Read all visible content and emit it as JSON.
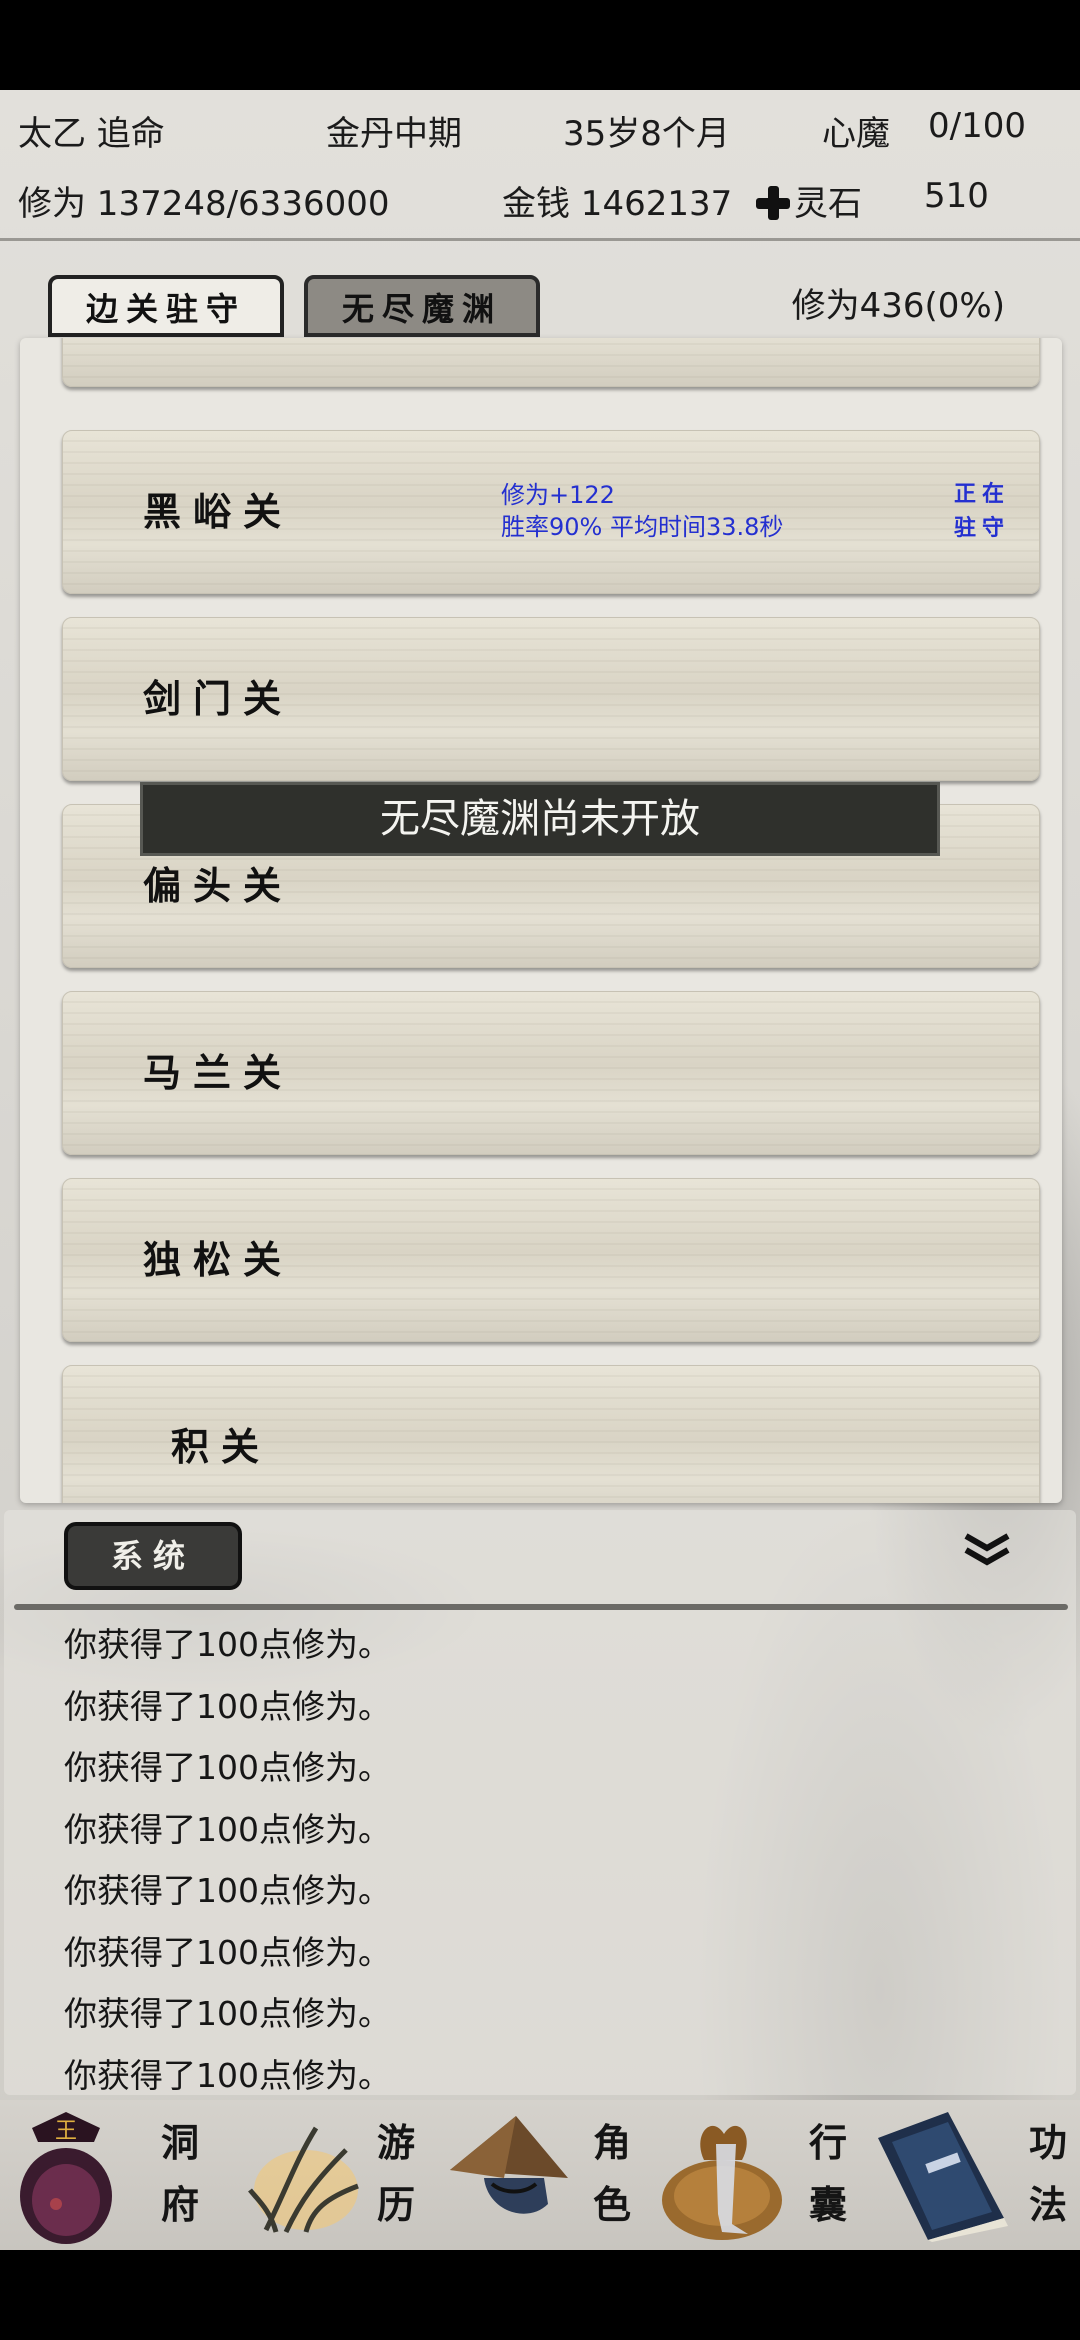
{
  "header": {
    "name": "太乙 追命",
    "realm": "金丹中期",
    "age": "35岁8个月",
    "demon_label": "心魔",
    "demon_value": "0/100",
    "xiuwei": "修为 137248/6336000",
    "money": "金钱 1462137",
    "spirit_stone_label": "灵石",
    "spirit_stone_value": "510"
  },
  "tabs": [
    {
      "label": "边关驻守",
      "active": true
    },
    {
      "label": "无尽魔渊",
      "active": false
    }
  ],
  "xiuwei_rate": "修为436(0%)",
  "passes": [
    {
      "name": "",
      "info1": "",
      "info2": "",
      "state": ""
    },
    {
      "name": "黑峪关",
      "info1": "修为+122",
      "info2": "胜率90% 平均时间33.8秒",
      "state": "正在驻守"
    },
    {
      "name": "剑门关",
      "info1": "",
      "info2": "",
      "state": ""
    },
    {
      "name": "偏头关",
      "info1": "",
      "info2": "",
      "state": ""
    },
    {
      "name": "马兰关",
      "info1": "",
      "info2": "",
      "state": ""
    },
    {
      "name": "独松关",
      "info1": "",
      "info2": "",
      "state": ""
    },
    {
      "name": "积关",
      "info1": "",
      "info2": "",
      "state": ""
    }
  ],
  "toast": "无尽魔渊尚未开放",
  "log": {
    "tab_label": "系统",
    "messages": [
      "你获得了100点修为。",
      "你获得了100点修为。",
      "你获得了100点修为。",
      "你获得了100点修为。",
      "你获得了100点修为。",
      "你获得了100点修为。",
      "你获得了100点修为。",
      "你获得了100点修为。"
    ]
  },
  "nav": [
    {
      "label_top": "洞",
      "label_bottom": "府",
      "icon": "cave-residence-icon"
    },
    {
      "label_top": "游",
      "label_bottom": "历",
      "icon": "travel-grass-icon"
    },
    {
      "label_top": "角",
      "label_bottom": "色",
      "icon": "character-hat-icon"
    },
    {
      "label_top": "行",
      "label_bottom": "囊",
      "icon": "bag-icon"
    },
    {
      "label_top": "功",
      "label_bottom": "法",
      "icon": "book-icon"
    }
  ]
}
